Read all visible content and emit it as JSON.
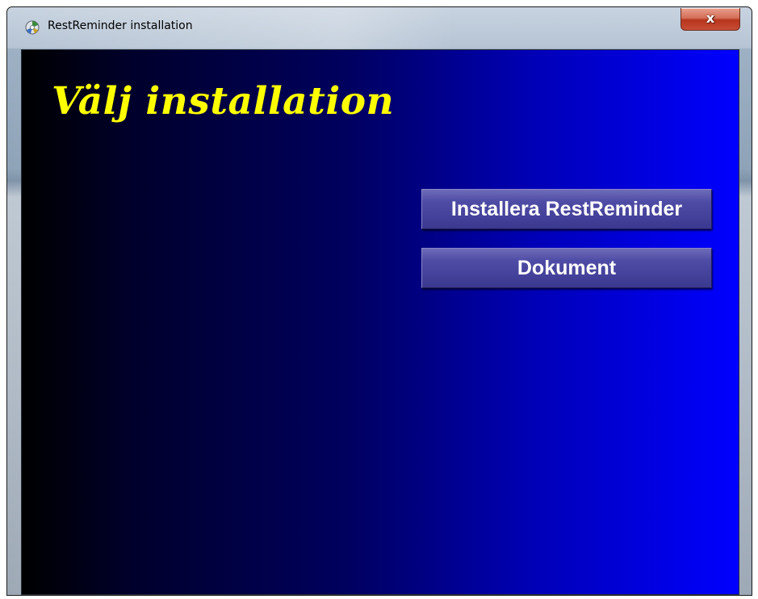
{
  "window": {
    "title": "RestReminder installation",
    "app_icon": "installer-disc-icon",
    "close_label": "x"
  },
  "main": {
    "heading": "Välj installation",
    "buttons": [
      {
        "label": "Installera RestReminder"
      },
      {
        "label": "Dokument"
      }
    ]
  },
  "colors": {
    "heading": "#ffff00",
    "background_start": "#000000",
    "background_end": "#0000ff",
    "button_face": "#4f4ca6"
  }
}
